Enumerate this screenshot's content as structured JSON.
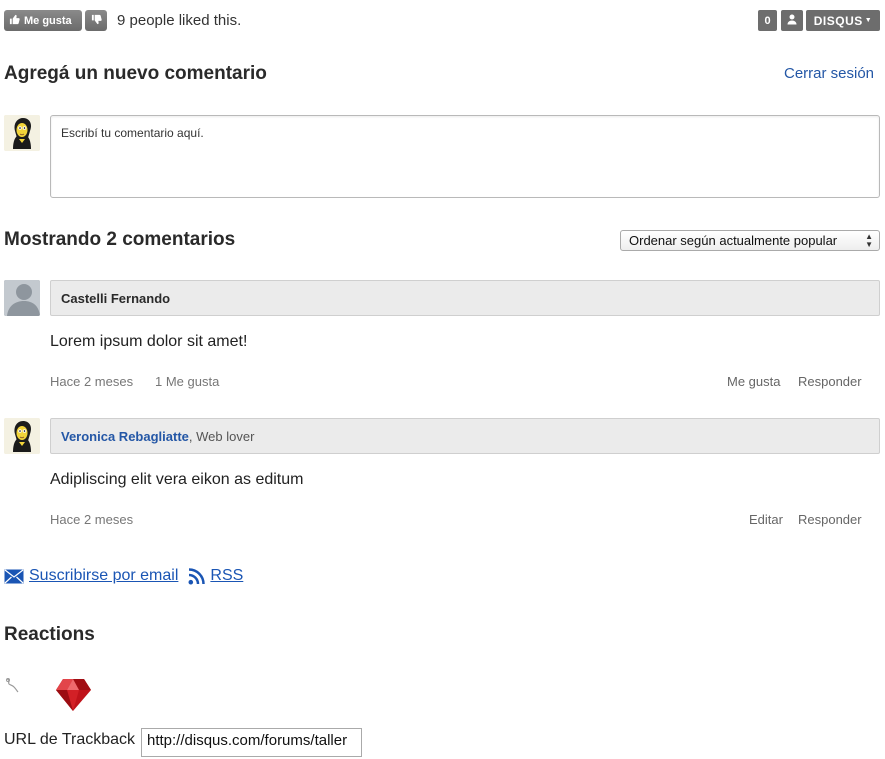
{
  "top_bar": {
    "like_label": "Me gusta",
    "liked_text": "9 people liked this.",
    "count": "0",
    "brand": "DISQUS"
  },
  "add_comment": {
    "heading": "Agregá un nuevo comentario",
    "logout": "Cerrar sesión",
    "placeholder": "Escribí tu comentario aquí."
  },
  "comments_section": {
    "heading": "Mostrando 2 comentarios",
    "sort_selected": "Ordenar según actualmente popular"
  },
  "comments": [
    {
      "author": "Castelli Fernando",
      "tagline": "",
      "body": "Lorem ipsum dolor sit amet!",
      "time": "Hace 2 meses",
      "likes": "1 Me gusta",
      "actions": [
        "Me gusta",
        "Responder"
      ]
    },
    {
      "author": "Veronica Rebagliatte",
      "tagline": ", Web lover",
      "body": "Adipliscing elit vera eikon as editum",
      "time": "Hace 2 meses",
      "likes": "",
      "actions": [
        "Editar",
        "Responder"
      ]
    }
  ],
  "subscribe": {
    "email_label": "Suscribirse por email",
    "rss_label": "RSS"
  },
  "reactions": {
    "heading": "Reactions"
  },
  "trackback": {
    "label": "URL de Trackback",
    "value": "http://disqus.com/forums/taller"
  },
  "icons": {
    "thumbs_up": "thumbs-up-icon",
    "thumbs_down": "thumbs-down-icon",
    "people": "people-icon",
    "email": "envelope-icon",
    "rss": "rss-icon",
    "ruby": "ruby-gem-icon",
    "reaction_source": "reaction-source-icon"
  },
  "colors": {
    "link": "#2457a6",
    "button_gray": "#6d6d6d",
    "header_bg": "#ebebeb",
    "ruby_red": "#c0131a"
  }
}
